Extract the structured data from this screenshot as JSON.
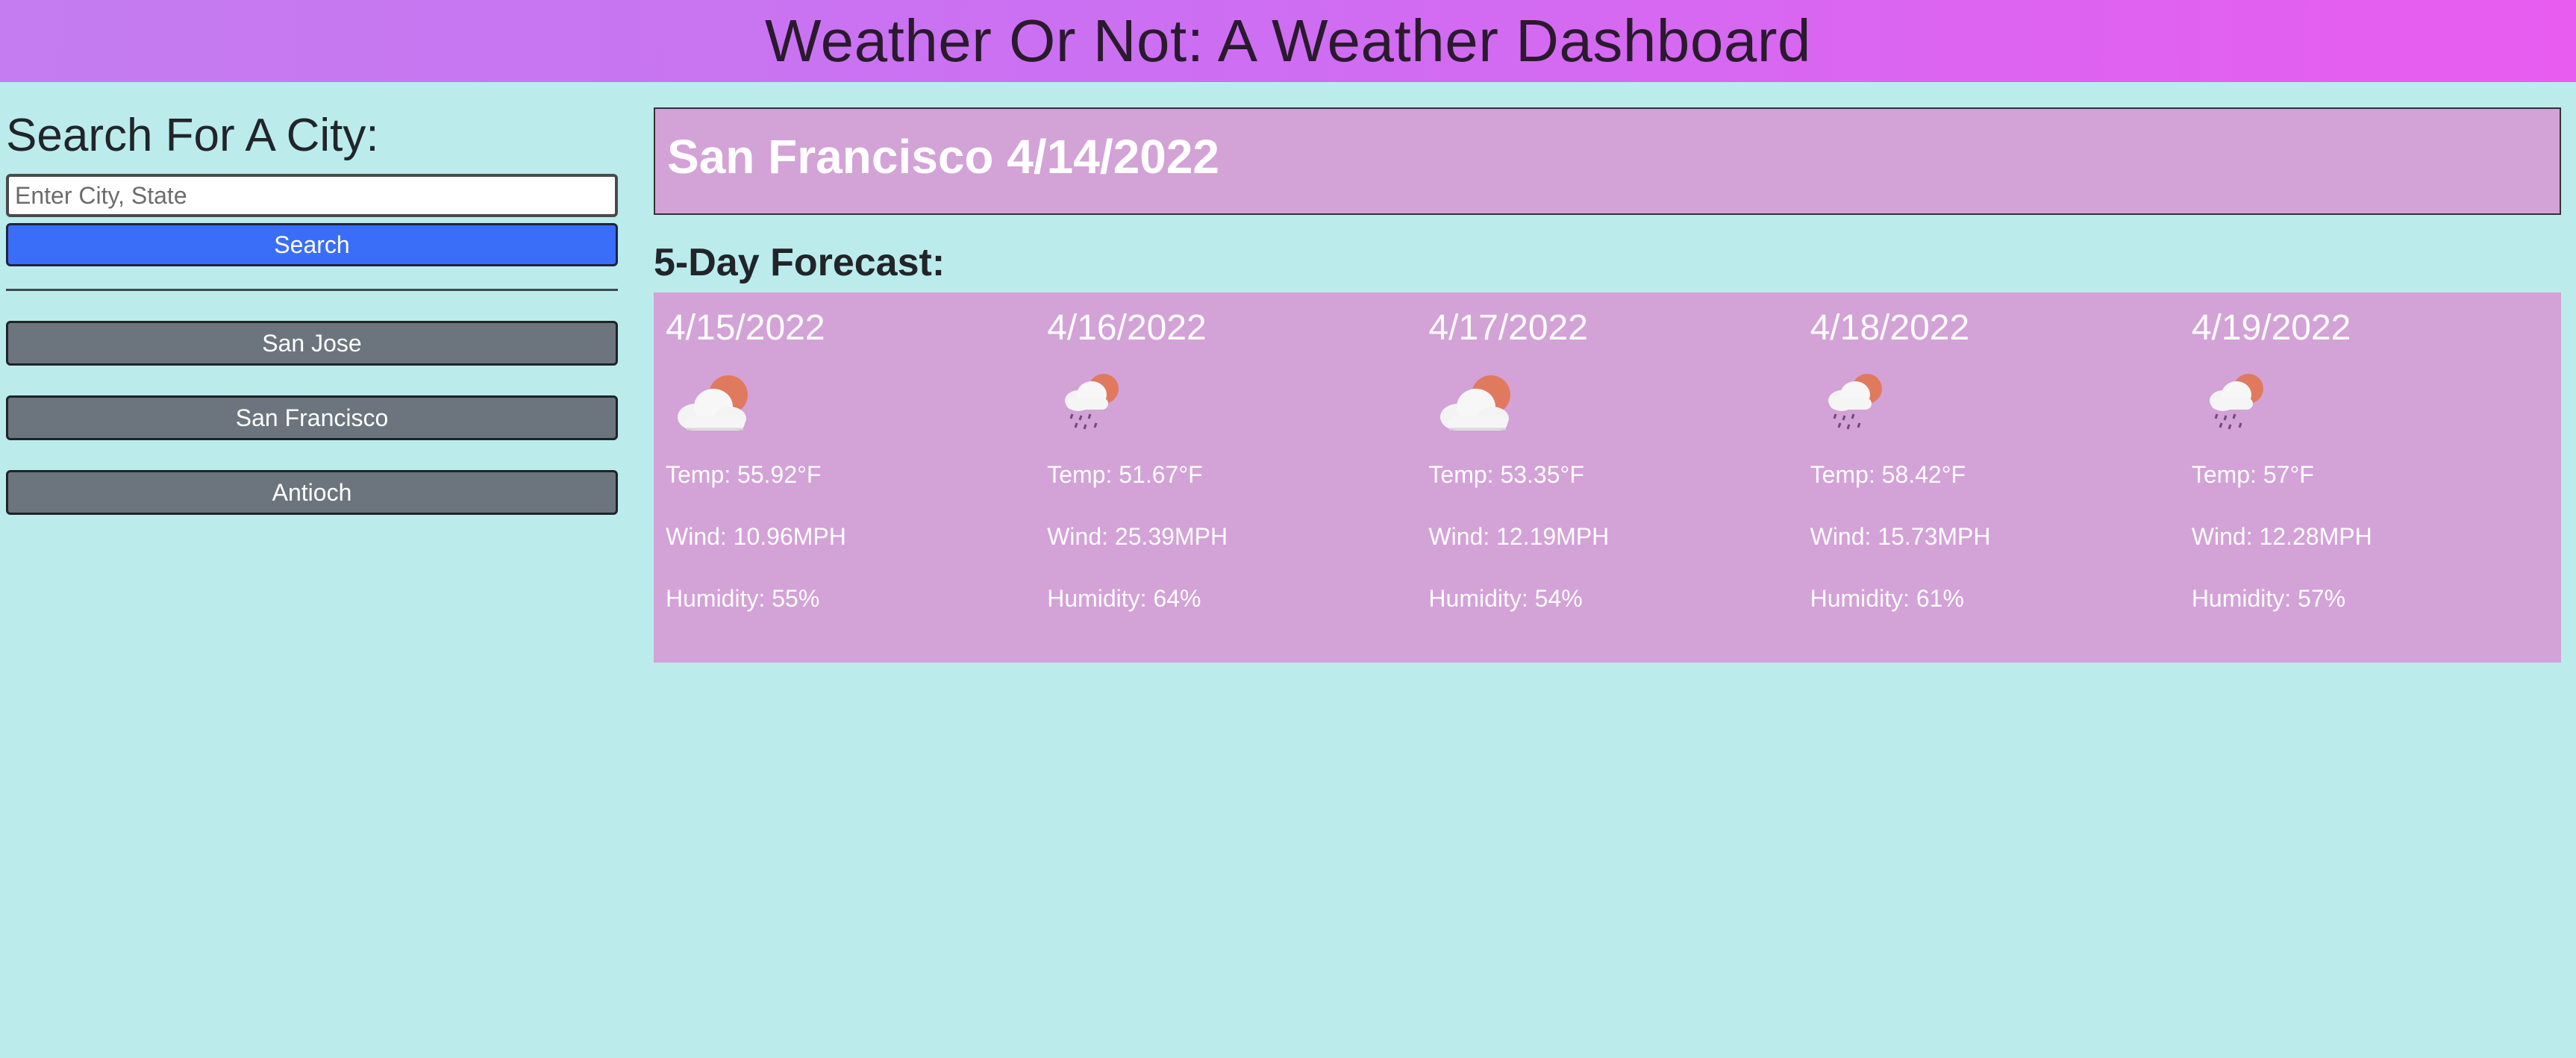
{
  "header": {
    "title": "Weather Or Not: A Weather Dashboard"
  },
  "sidebar": {
    "heading": "Search For A City:",
    "search_placeholder": "Enter City, State",
    "search_label": "Search",
    "history": [
      "San Jose",
      "San Francisco",
      "Antioch"
    ]
  },
  "current": {
    "title": "San Francisco 4/14/2022"
  },
  "forecast": {
    "heading": "5-Day Forecast:",
    "days": [
      {
        "date": "4/15/2022",
        "icon": "partly-cloudy-icon",
        "temp": "Temp: 55.92°F",
        "wind": "Wind: 10.96MPH",
        "humidity": "Humidity: 55%"
      },
      {
        "date": "4/16/2022",
        "icon": "rain-sun-icon",
        "temp": "Temp: 51.67°F",
        "wind": "Wind: 25.39MPH",
        "humidity": "Humidity: 64%"
      },
      {
        "date": "4/17/2022",
        "icon": "partly-cloudy-icon",
        "temp": "Temp: 53.35°F",
        "wind": "Wind: 12.19MPH",
        "humidity": "Humidity: 54%"
      },
      {
        "date": "4/18/2022",
        "icon": "rain-sun-icon",
        "temp": "Temp: 58.42°F",
        "wind": "Wind: 15.73MPH",
        "humidity": "Humidity: 61%"
      },
      {
        "date": "4/19/2022",
        "icon": "rain-sun-icon",
        "temp": "Temp: 57°F",
        "wind": "Wind: 12.28MPH",
        "humidity": "Humidity: 57%"
      }
    ]
  },
  "colors": {
    "page_bg": "#bcebec",
    "panel": "#d3a2d7",
    "search_button": "#3b6ef8",
    "history_button": "#6c757d"
  }
}
